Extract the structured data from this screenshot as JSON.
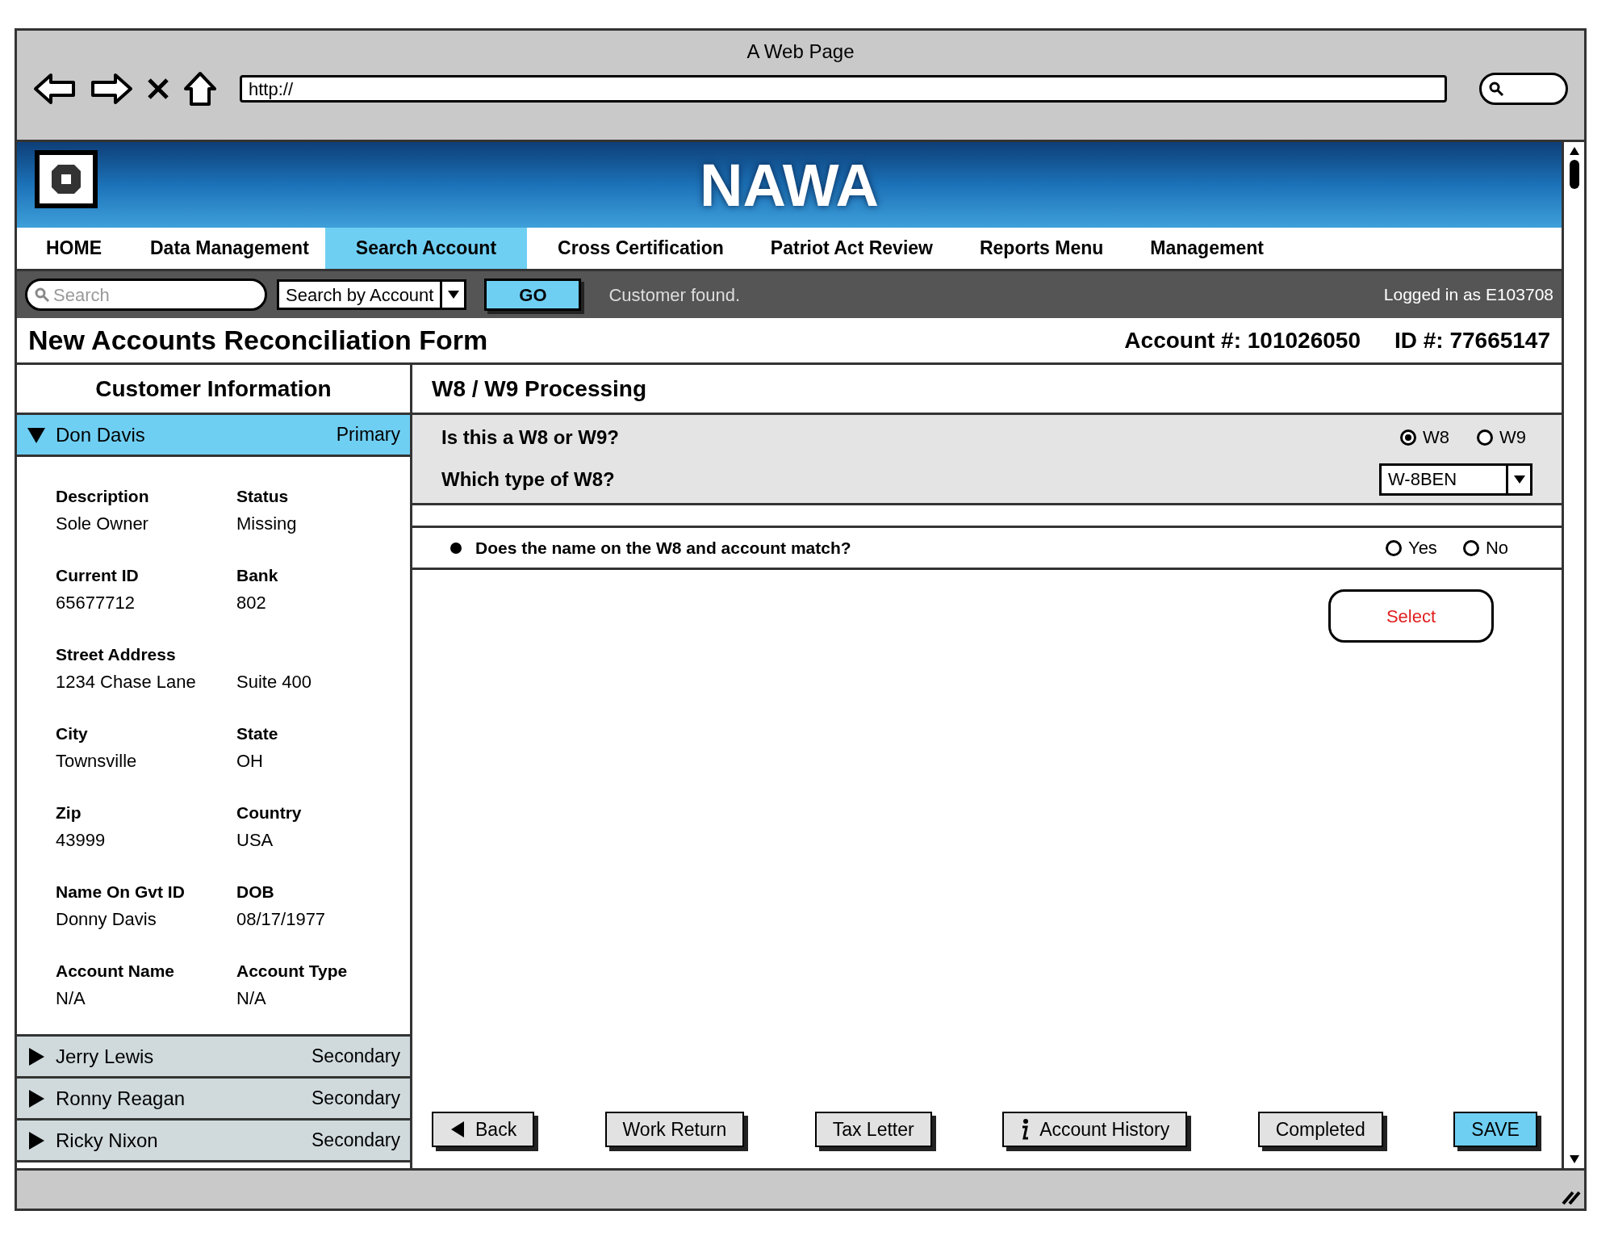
{
  "browser": {
    "title": "A Web Page",
    "url": "http://"
  },
  "header": {
    "title": "NAWA"
  },
  "nav": [
    {
      "label": "HOME",
      "selected": false
    },
    {
      "label": "Data Management",
      "selected": false
    },
    {
      "label": "Search Account",
      "selected": true
    },
    {
      "label": "Cross Certification",
      "selected": false
    },
    {
      "label": "Patriot Act Review",
      "selected": false
    },
    {
      "label": "Reports Menu",
      "selected": false
    },
    {
      "label": "Management",
      "selected": false
    }
  ],
  "toolbar": {
    "search": {
      "placeholder": "Search"
    },
    "search_by": "Search by Account",
    "go": "GO",
    "message": "Customer found.",
    "logged_in": "Logged in as E103708"
  },
  "form": {
    "title": "New Accounts Reconciliation Form",
    "account": "Account #: 101026050",
    "id": "ID #: 77665147"
  },
  "customer_panel": {
    "title": "Customer Information",
    "customers": [
      {
        "name": "Don Davis",
        "role": "Primary",
        "expanded": true,
        "fields": [
          {
            "label": "Description",
            "value": "Sole Owner"
          },
          {
            "label": "Status",
            "value": "Missing"
          },
          {
            "label": "Current ID",
            "value": "65677712"
          },
          {
            "label": "Bank",
            "value": "802"
          },
          {
            "label": "Street Address",
            "value": "1234 Chase Lane"
          },
          {
            "value": "Suite 400"
          },
          {
            "label": "City",
            "value": "Townsville"
          },
          {
            "label": "State",
            "value": "OH"
          },
          {
            "label": "Zip",
            "value": "43999"
          },
          {
            "label": "Country",
            "value": "USA"
          },
          {
            "label": "Name On Gvt ID",
            "value": "Donny Davis"
          },
          {
            "label": "DOB",
            "value": "08/17/1977"
          },
          {
            "label": "Account Name",
            "value": "N/A"
          },
          {
            "label": "Account Type",
            "value": "N/A"
          }
        ]
      },
      {
        "name": "Jerry Lewis",
        "role": "Secondary",
        "expanded": false
      },
      {
        "name": "Ronny Reagan",
        "role": "Secondary",
        "expanded": false
      },
      {
        "name": "Ricky Nixon",
        "role": "Secondary",
        "expanded": false
      }
    ]
  },
  "processing": {
    "title": "W8 / W9 Processing",
    "questions": [
      {
        "kind": "radio",
        "label": "Is this a W8 or W9?",
        "options": [
          {
            "label": "W8",
            "selected": true
          },
          {
            "label": "W9",
            "selected": false
          }
        ]
      },
      {
        "kind": "select",
        "label": "Which type of W8?",
        "value": "W-8BEN"
      }
    ],
    "match": {
      "label": "Does the name on the W8 and account match?",
      "options": [
        {
          "label": "Yes",
          "selected": false
        },
        {
          "label": "No",
          "selected": false
        }
      ]
    },
    "callout": "Select"
  },
  "buttons": [
    {
      "label": "Back",
      "kind": "back",
      "primary": false
    },
    {
      "label": "Work Return",
      "kind": "plain",
      "primary": false
    },
    {
      "label": "Tax Letter",
      "kind": "plain",
      "primary": false
    },
    {
      "label": "Account History",
      "kind": "info",
      "primary": false
    },
    {
      "label": "Completed",
      "kind": "plain",
      "primary": false
    },
    {
      "label": "SAVE",
      "kind": "plain",
      "primary": true
    }
  ]
}
